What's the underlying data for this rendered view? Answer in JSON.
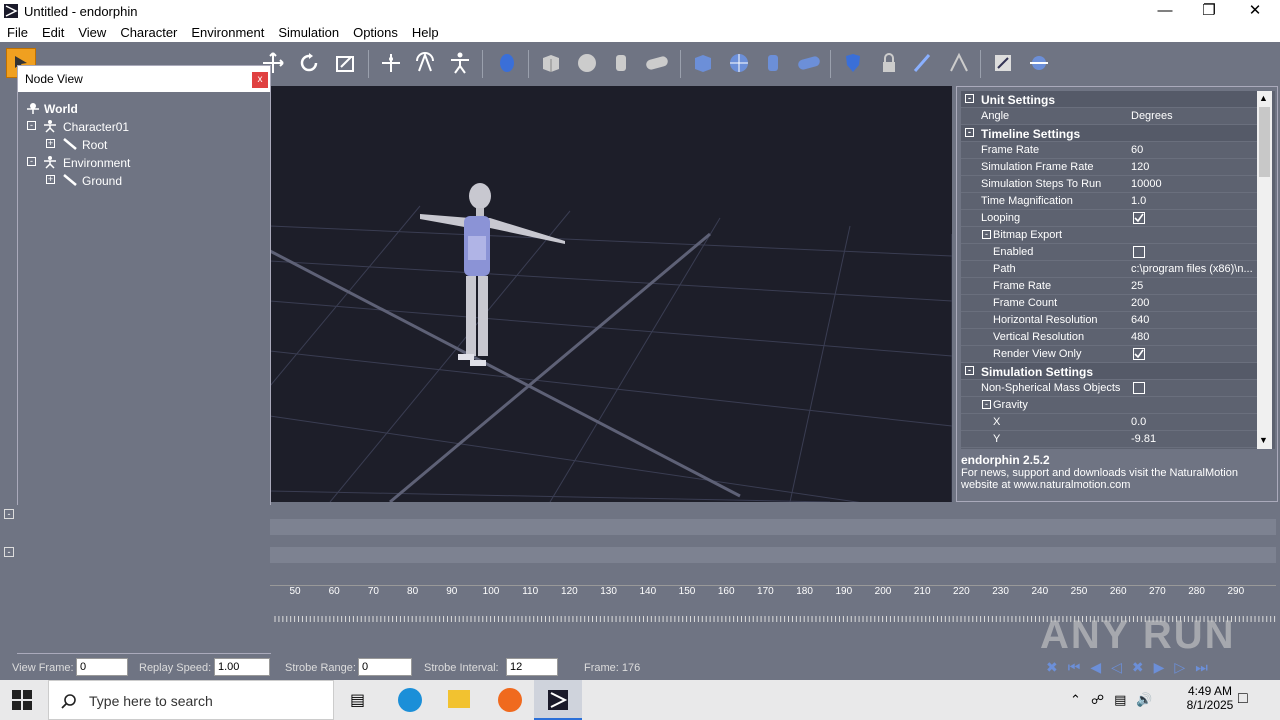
{
  "window": {
    "title": "Untitled - endorphin"
  },
  "menu": [
    "File",
    "Edit",
    "View",
    "Character",
    "Environment",
    "Simulation",
    "Options",
    "Help"
  ],
  "node_view": {
    "title": "Node View",
    "close_label": "x",
    "tree": {
      "world": "World",
      "character": "Character01",
      "root": "Root",
      "environment": "Environment",
      "ground": "Ground"
    }
  },
  "properties": {
    "unit_settings": "Unit Settings",
    "angle_label": "Angle",
    "angle_value": "Degrees",
    "timeline_settings": "Timeline Settings",
    "frame_rate_label": "Frame Rate",
    "frame_rate_value": "60",
    "sim_frame_rate_label": "Simulation Frame Rate",
    "sim_frame_rate_value": "120",
    "sim_steps_label": "Simulation Steps To Run",
    "sim_steps_value": "10000",
    "time_mag_label": "Time Magnification",
    "time_mag_value": "1.0",
    "looping_label": "Looping",
    "bitmap_export": "Bitmap Export",
    "enabled_label": "Enabled",
    "path_label": "Path",
    "path_value": "c:\\program files (x86)\\n...",
    "bm_frame_rate_label": "Frame Rate",
    "bm_frame_rate_value": "25",
    "frame_count_label": "Frame Count",
    "frame_count_value": "200",
    "h_res_label": "Horizontal Resolution",
    "h_res_value": "640",
    "v_res_label": "Vertical Resolution",
    "v_res_value": "480",
    "render_view_label": "Render View Only",
    "simulation_settings": "Simulation Settings",
    "non_spherical_label": "Non-Spherical Mass Objects",
    "gravity": "Gravity",
    "x_label": "X",
    "x_value": "0.0",
    "y_label": "Y",
    "y_value": "-9.81"
  },
  "info": {
    "version": "endorphin 2.5.2",
    "line1": "For news, support and downloads visit the NaturalMotion",
    "line2": "website at www.naturalmotion.com"
  },
  "ruler": [
    "50",
    "60",
    "70",
    "80",
    "90",
    "100",
    "110",
    "120",
    "130",
    "140",
    "150",
    "160",
    "170",
    "180",
    "190",
    "200",
    "210",
    "220",
    "230",
    "240",
    "250",
    "260",
    "270",
    "280",
    "290"
  ],
  "status": {
    "view_frame_label": "View Frame:",
    "view_frame_value": "0",
    "replay_speed_label": "Replay Speed:",
    "replay_speed_value": "1.00",
    "strobe_range_label": "Strobe Range:",
    "strobe_range_value": "0",
    "strobe_interval_label": "Strobe Interval:",
    "strobe_interval_value": "12",
    "frame_readout": "Frame: 176"
  },
  "taskbar": {
    "search_placeholder": "Type here to search",
    "time": "4:49 AM",
    "date": "8/1/2025"
  },
  "watermark": "ANY RUN"
}
